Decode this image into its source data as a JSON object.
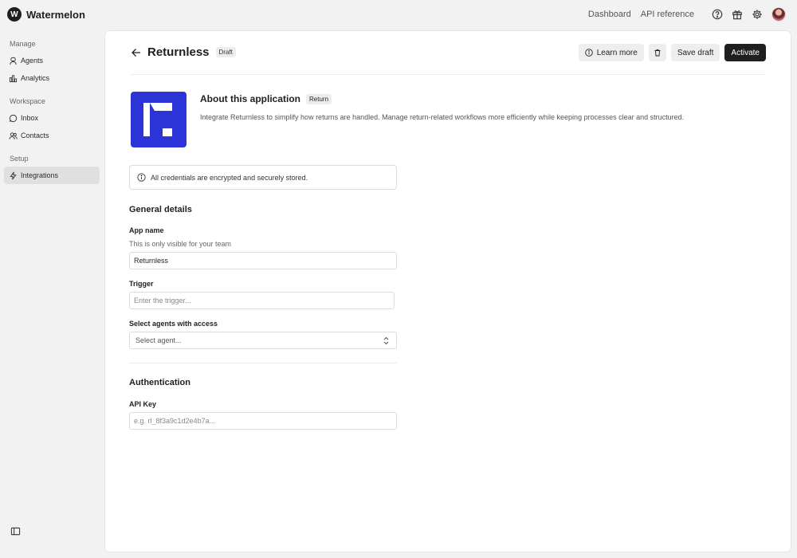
{
  "brand": {
    "logo_letter": "W",
    "name": "Watermelon"
  },
  "topnav": {
    "dashboard": "Dashboard",
    "api_reference": "API reference"
  },
  "sidebar": {
    "sections": [
      {
        "heading": "Manage",
        "items": [
          {
            "label": "Agents",
            "icon": "agents-icon"
          },
          {
            "label": "Analytics",
            "icon": "analytics-icon"
          }
        ]
      },
      {
        "heading": "Workspace",
        "items": [
          {
            "label": "Inbox",
            "icon": "inbox-icon"
          },
          {
            "label": "Contacts",
            "icon": "contacts-icon"
          }
        ]
      },
      {
        "heading": "Setup",
        "items": [
          {
            "label": "Integrations",
            "icon": "lightning-icon",
            "active": true
          }
        ]
      }
    ]
  },
  "header": {
    "title": "Returnless",
    "status": "Draft"
  },
  "actions": {
    "learn_more": "Learn more",
    "save_draft": "Save draft",
    "activate": "Activate"
  },
  "about": {
    "title": "About this application",
    "badge": "Return",
    "description": "Integrate Returnless to simplify how returns are handled. Manage return-related workflows more efficiently while keeping processes clear and structured.",
    "logo_color": "#2c34d8"
  },
  "notice": "All credentials are encrypted and securely stored.",
  "general": {
    "title": "General details",
    "app_name": {
      "label": "App name",
      "help": "This is only visible for your team",
      "value": "Returnless"
    },
    "trigger": {
      "label": "Trigger",
      "placeholder": "Enter the trigger..."
    },
    "agents": {
      "label": "Select agents with access",
      "placeholder": "Select agent..."
    }
  },
  "authentication": {
    "title": "Authentication",
    "api_key": {
      "label": "API Key",
      "placeholder": "e.g. rl_8f3a9c1d2e4b7a..."
    }
  },
  "colors": {
    "accent": "#1f1f1f",
    "app_brand": "#2c34d8"
  }
}
